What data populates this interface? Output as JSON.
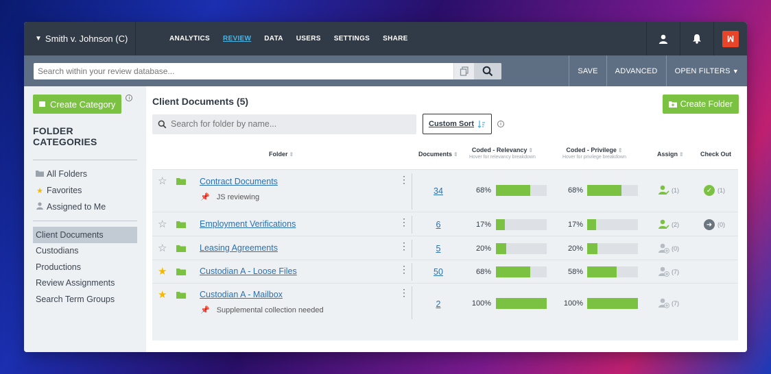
{
  "case_title": "Smith v. Johnson (C)",
  "nav": [
    "ANALYTICS",
    "REVIEW",
    "DATA",
    "USERS",
    "SETTINGS",
    "SHARE"
  ],
  "nav_active": "REVIEW",
  "search": {
    "placeholder": "Search within your review database..."
  },
  "actions": {
    "save": "SAVE",
    "advanced": "ADVANCED",
    "open_filters": "OPEN FILTERS"
  },
  "sidebar": {
    "create_category": "Create Category",
    "folder_categories": "FOLDER CATEGORIES",
    "quick": [
      "All Folders",
      "Favorites",
      "Assigned to Me"
    ],
    "categories": [
      "Client Documents",
      "Custodians",
      "Productions",
      "Review Assignments",
      "Search Term Groups"
    ],
    "active_category": "Client Documents"
  },
  "main": {
    "title": "Client Documents (5)",
    "create_folder": "Create Folder",
    "folder_search_placeholder": "Search for folder by name...",
    "custom_sort": "Custom Sort"
  },
  "table": {
    "headers": {
      "folder": "Folder",
      "documents": "Documents",
      "relevancy": "Coded - Relevancy",
      "relevancy_sub": "Hover for relevancy breakdown",
      "privilege": "Coded - Privilege",
      "privilege_sub": "Hover for privilege breakdown",
      "assign": "Assign",
      "checkout": "Check Out"
    },
    "rows": [
      {
        "starred": false,
        "name": "Contract Documents",
        "note": "JS reviewing",
        "documents": "34",
        "relevancy": "68%",
        "relevancy_value": 68,
        "privilege": "68%",
        "privilege_value": 68,
        "assign_count": "(1)",
        "assigned": true,
        "checkout": "(1)",
        "checkout_state": "done"
      },
      {
        "starred": false,
        "name": "Employment Verifications",
        "note": "",
        "documents": "6",
        "relevancy": "17%",
        "relevancy_value": 17,
        "privilege": "17%",
        "privilege_value": 17,
        "assign_count": "(2)",
        "assigned": true,
        "checkout": "(0)",
        "checkout_state": "available"
      },
      {
        "starred": false,
        "name": "Leasing Agreements",
        "note": "",
        "documents": "5",
        "relevancy": "20%",
        "relevancy_value": 20,
        "privilege": "20%",
        "privilege_value": 20,
        "assign_count": "(0)",
        "assigned": false,
        "checkout": "",
        "checkout_state": "none"
      },
      {
        "starred": true,
        "name": "Custodian A - Loose Files",
        "note": "",
        "documents": "50",
        "relevancy": "68%",
        "relevancy_value": 68,
        "privilege": "58%",
        "privilege_value": 58,
        "assign_count": "(7)",
        "assigned": false,
        "checkout": "",
        "checkout_state": "none"
      },
      {
        "starred": true,
        "name": "Custodian A - Mailbox",
        "note": "Supplemental collection needed",
        "documents": "2",
        "relevancy": "100%",
        "relevancy_value": 100,
        "privilege": "100%",
        "privilege_value": 100,
        "assign_count": "(7)",
        "assigned": false,
        "checkout": "",
        "checkout_state": "none"
      }
    ]
  },
  "colors": {
    "accent_green": "#7cc242",
    "nav_bg": "#313b48",
    "link_blue": "#2a6fb0",
    "star_yellow": "#f5b800"
  }
}
